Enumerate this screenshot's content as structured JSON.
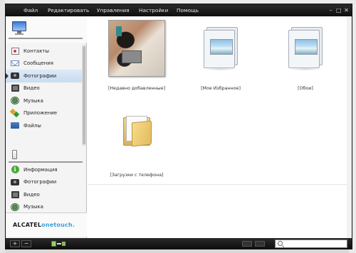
{
  "menu": {
    "items": [
      "Файл",
      "Редактировать",
      "Управления",
      "Настройки",
      "Помощь"
    ],
    "minimize": "–",
    "maximize": "□",
    "close": "✕"
  },
  "sidebar": {
    "device_items": [
      {
        "label": "Контакты",
        "icon": "contacts-icon"
      },
      {
        "label": "Сообщения",
        "icon": "messages-icon"
      },
      {
        "label": "Фотографии",
        "icon": "camera-icon",
        "active": true
      },
      {
        "label": "Видео",
        "icon": "video-icon"
      },
      {
        "label": "Музыка",
        "icon": "music-icon"
      },
      {
        "label": "Приложение",
        "icon": "applications-icon"
      },
      {
        "label": "Файлы",
        "icon": "files-icon"
      }
    ],
    "phone_items": [
      {
        "label": "Информация",
        "icon": "info-icon"
      },
      {
        "label": "Фотографии",
        "icon": "camera-icon"
      },
      {
        "label": "Видео",
        "icon": "video-icon"
      },
      {
        "label": "Музыка",
        "icon": "music-icon"
      }
    ],
    "info_glyph": "i",
    "brand": {
      "part1": "ALCATEL",
      "part2": "onetouch."
    }
  },
  "albums": [
    {
      "caption": "[Недавно добавленные]",
      "kind": "photo"
    },
    {
      "caption": "[Мое Избранное]",
      "kind": "picture"
    },
    {
      "caption": "[Обои]",
      "kind": "picture"
    },
    {
      "caption": "[Загрузки с телефона]",
      "kind": "folder"
    }
  ],
  "bottombar": {
    "add_label": "+",
    "remove_label": "−",
    "search_placeholder": ""
  },
  "colors": {
    "menubar": "#1a1a1a",
    "active_item": "#c9dcf1",
    "brand_accent": "#3aa0d6"
  }
}
